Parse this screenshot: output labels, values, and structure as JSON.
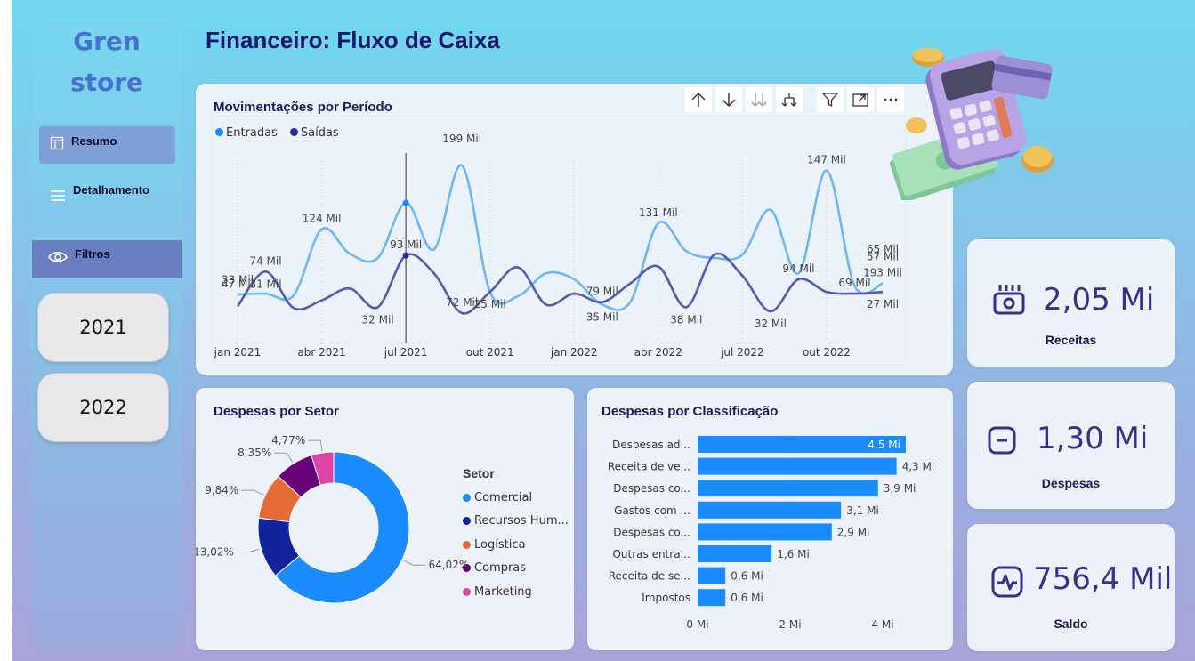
{
  "sidebar": {
    "brand_line1": "Gren",
    "brand_line2": "store",
    "nav": [
      {
        "label": "Resumo",
        "icon": "layout-icon",
        "active": true
      },
      {
        "label": "Detalhamento",
        "icon": "menu-lines-icon",
        "active": false
      },
      {
        "label": "Filtros",
        "icon": "eye-icon",
        "active": true
      }
    ],
    "years": [
      "2021",
      "2022"
    ]
  },
  "header": {
    "title": "Financeiro: Fluxo de Caixa"
  },
  "colors": {
    "entradas": "#4aa8ee",
    "saidas": "#4b4fa8",
    "comercial": "#1a8cff",
    "recursos_humanos": "#12239e",
    "logistica": "#e66c37",
    "compras": "#6b007b",
    "marketing": "#e044a7",
    "bar": "#1a8cff"
  },
  "movimentacoes": {
    "title": "Movimentações por Período",
    "toolbar_icons": [
      "sort-up-icon",
      "sort-down-icon",
      "drill-down-all-icon",
      "expand-hierarchy-icon",
      "filter-icon",
      "focus-mode-icon",
      "more-options-icon"
    ],
    "chart_data": {
      "type": "line",
      "categories": [
        "jan 2021",
        "fev 2021",
        "mar 2021",
        "abr 2021",
        "mai 2021",
        "jun 2021",
        "jul 2021",
        "ago 2021",
        "set 2021",
        "out 2021",
        "nov 2021",
        "dez 2021",
        "jan 2022",
        "fev 2022",
        "mar 2022",
        "abr 2022",
        "mai 2022",
        "jun 2022",
        "jul 2022",
        "ago 2022",
        "set 2022",
        "out 2022",
        "nov 2022",
        "dez 2022"
      ],
      "x_tick_labels": [
        "jan 2021",
        "abr 2021",
        "jul 2021",
        "out 2021",
        "jan 2022",
        "abr 2022",
        "jul 2022",
        "out 2022"
      ],
      "series": [
        {
          "name": "Entradas",
          "values": [
            47,
            48,
            46,
            124,
            95,
            90,
            155,
            100,
            199,
            50,
            45,
            72,
            65,
            35,
            38,
            131,
            98,
            90,
            94,
            147,
            72,
            193,
            57,
            60
          ]
        },
        {
          "name": "Saídas",
          "values": [
            33,
            74,
            31,
            40,
            54,
            32,
            93,
            72,
            25,
            50,
            79,
            35,
            48,
            38,
            60,
            80,
            32,
            94,
            69,
            27,
            65,
            50,
            48,
            50
          ]
        }
      ],
      "point_labels": [
        {
          "series": "Entradas",
          "i": 0,
          "text": "47 Mil"
        },
        {
          "series": "Saídas",
          "i": 0,
          "text": "33 Mil"
        },
        {
          "series": "Saídas",
          "i": 1,
          "text": "74 Mil"
        },
        {
          "series": "Saídas",
          "i": 1,
          "text": "31 Mil",
          "below": true
        },
        {
          "series": "Entradas",
          "i": 3,
          "text": "124 Mil"
        },
        {
          "series": "Saídas",
          "i": 5,
          "text": "32 Mil",
          "below": true
        },
        {
          "series": "Saídas",
          "i": 6,
          "text": "93 Mil"
        },
        {
          "series": "Saídas",
          "i": 8,
          "text": "72 Mil"
        },
        {
          "series": "Entradas",
          "i": 8,
          "text": "199 Mil"
        },
        {
          "series": "Saídas",
          "i": 9,
          "text": "25 Mil",
          "below": true
        },
        {
          "series": "Saídas",
          "i": 13,
          "text": "79 Mil"
        },
        {
          "series": "Entradas",
          "i": 13,
          "text": "35 Mil",
          "below": true
        },
        {
          "series": "Saídas",
          "i": 16,
          "text": "38 Mil",
          "below": true
        },
        {
          "series": "Entradas",
          "i": 15,
          "text": "131 Mil"
        },
        {
          "series": "Saídas",
          "i": 19,
          "text": "32 Mil",
          "below": true
        },
        {
          "series": "Saídas",
          "i": 20,
          "text": "94 Mil"
        },
        {
          "series": "Entradas",
          "i": 21,
          "text": "147 Mil"
        },
        {
          "series": "Saídas",
          "i": 22,
          "text": "69 Mil"
        },
        {
          "series": "Entradas",
          "i": 23,
          "text": "193 Mil"
        },
        {
          "series": "Saídas",
          "i": 23,
          "text": "27 Mil",
          "below": true
        },
        {
          "series": "Entradas",
          "i": 23,
          "text": "57 Mil"
        },
        {
          "series": "Saídas",
          "i": 23,
          "text": "65 Mil"
        }
      ],
      "legend": "top-left",
      "grid": false
    }
  },
  "despesas_setor": {
    "title": "Despesas por Setor",
    "legend_title": "Setor",
    "chart_data": {
      "type": "pie",
      "labels": [
        "Comercial",
        "Recursos Hum...",
        "Logística",
        "Compras",
        "Marketing"
      ],
      "values": [
        64.02,
        13.02,
        9.84,
        8.35,
        4.77
      ],
      "value_labels": [
        "64,02%",
        "13,02%",
        "9,84%",
        "8,35%",
        "4,77%"
      ],
      "legend": "right"
    }
  },
  "despesas_classificacao": {
    "title": "Despesas por Classificação",
    "chart_data": {
      "type": "bar",
      "orientation": "horizontal",
      "categories": [
        "Despesas ad...",
        "Receita de ve...",
        "Despesas co...",
        "Gastos com ...",
        "Despesas co...",
        "Outras entra...",
        "Receita de se...",
        "Impostos"
      ],
      "values": [
        4.5,
        4.3,
        3.9,
        3.1,
        2.9,
        1.6,
        0.6,
        0.6
      ],
      "value_labels": [
        "4,5 Mi",
        "4,3 Mi",
        "3,9 Mi",
        "3,1 Mi",
        "2,9 Mi",
        "1,6 Mi",
        "0,6 Mi",
        "0,6 Mi"
      ],
      "x_ticks": [
        "0 Mi",
        "2 Mi",
        "4 Mi"
      ],
      "xlim": [
        0,
        4.5
      ],
      "grid": true
    }
  },
  "kpis": [
    {
      "value": "2,05 Mi",
      "label": "Receitas",
      "icon": "wallet-icon"
    },
    {
      "value": "1,30 Mi",
      "label": "Despesas",
      "icon": "minus-square-icon"
    },
    {
      "value": "756,4 Mil",
      "label": "Saldo",
      "icon": "pulse-icon"
    }
  ]
}
